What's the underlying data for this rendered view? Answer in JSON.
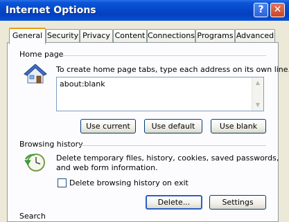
{
  "window": {
    "title": "Internet Options",
    "help_glyph": "?",
    "close_glyph": "✕"
  },
  "tabs": [
    {
      "label": "General",
      "active": true
    },
    {
      "label": "Security"
    },
    {
      "label": "Privacy"
    },
    {
      "label": "Content"
    },
    {
      "label": "Connections"
    },
    {
      "label": "Programs"
    },
    {
      "label": "Advanced"
    }
  ],
  "home_page": {
    "group_label": "Home page",
    "description": "To create home page tabs, type each address on its own line.",
    "address_value": "about:blank",
    "icon": "home-icon",
    "buttons": {
      "use_current": "Use current",
      "use_default": "Use default",
      "use_blank": "Use blank"
    }
  },
  "browsing_history": {
    "group_label": "Browsing history",
    "description_line1": "Delete temporary files, history, cookies, saved passwords,",
    "description_line2": "and web form information.",
    "icon": "history-clock-icon",
    "checkbox_label": "Delete browsing history on exit",
    "checkbox_checked": false,
    "buttons": {
      "delete": "Delete...",
      "settings": "Settings"
    }
  },
  "next_group": {
    "group_label": "Search"
  },
  "colors": {
    "titlebar": "#0548c8",
    "tab_active_accent": "#e89b12",
    "dialog_bg": "#ece9d8",
    "panel_bg": "#fcfcfe"
  }
}
